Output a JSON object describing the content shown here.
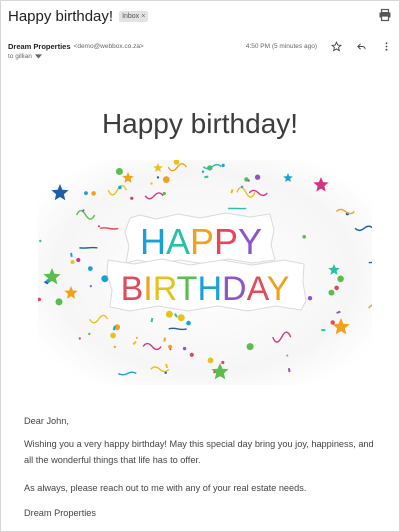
{
  "email": {
    "subject": "Happy birthday!",
    "label": "Inbox",
    "sender_name": "Dream Properties",
    "sender_email": "<demo@webbox.co.za>",
    "time": "4:50 PM (5 minutes ago)",
    "to": "to gillian"
  },
  "content": {
    "headline": "Happy birthday!",
    "banner_word_1": "HAPPY",
    "banner_word_2": "BIRTHDAY",
    "greeting": "Dear John,",
    "paragraph_1": "Wishing you a very happy birthday! May this special day bring you joy, happiness, and all the wonderful things that life has to offer.",
    "paragraph_2": "As always, please reach out to me with any of your real estate needs.",
    "signature": "Dream Properties"
  },
  "colors": {
    "happy": [
      "#1aa0d8",
      "#2bbfa6",
      "#f0a21c",
      "#e8445a",
      "#8e54c9"
    ],
    "birthday": [
      "#e14b5a",
      "#f0a21c",
      "#e6c21d",
      "#5bbd4e",
      "#1aa0d8",
      "#8e54c9",
      "#e14b5a",
      "#f0a21c"
    ]
  }
}
